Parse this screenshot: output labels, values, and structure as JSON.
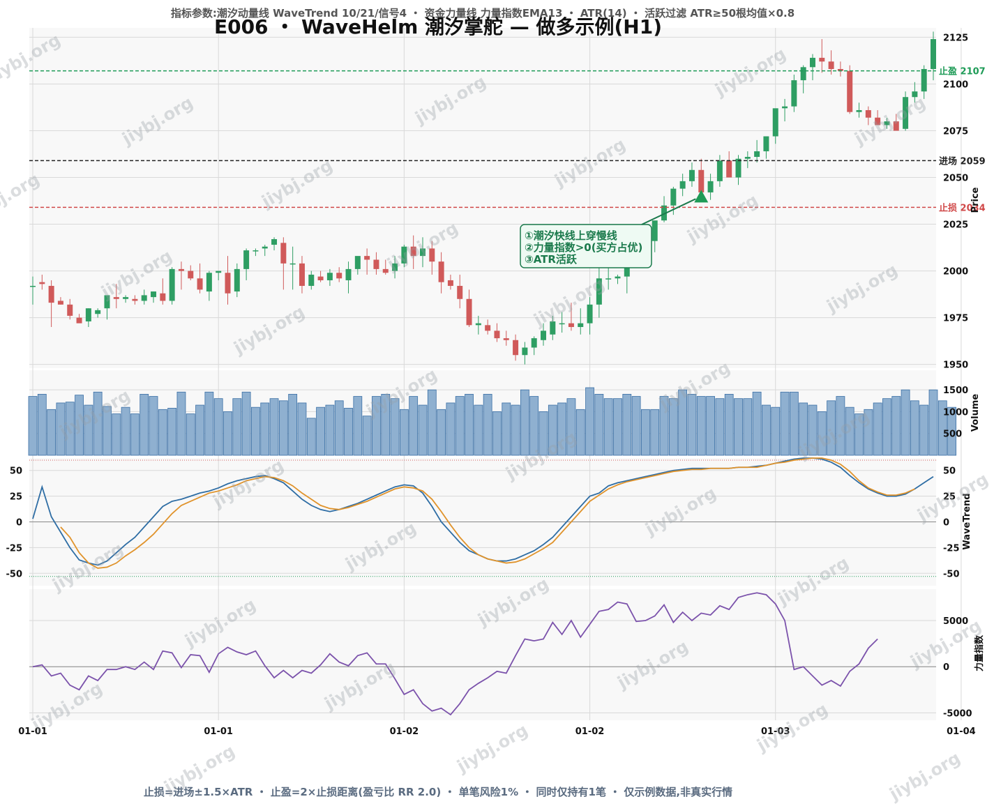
{
  "header": {
    "params": "指标参数:潮汐动量线 WaveTrend 10/21/信号4 ・ 资金力量线 力量指数EMA13 ・ ATR(14) ・ 活跃过滤 ATR≥50根均值×0.8",
    "title": "E006 ・ WaveHelm 潮汐掌舵 — 做多示例(H1)"
  },
  "footer": {
    "note": "止损=进场±1.5×ATR ・ 止盈=2×止损距离(盈亏比 RR 2.0) ・ 单笔风险1% ・ 同时仅持有1笔 ・ 仅示例数据,非真实行情"
  },
  "watermark": "jiybj.org",
  "colors": {
    "up": "#2e9e63",
    "down": "#d05a5a",
    "volume": "#8fb0d0",
    "volume_edge": "#3a6fa5",
    "wt_fast": "#2e6da4",
    "wt_slow": "#e0932b",
    "force": "#7b52ab",
    "take_profit": "#1e9b57",
    "entry": "#222222",
    "stop_loss": "#d04848",
    "annotation": "#1b7a4c",
    "annotation_bg": "#eefaf3"
  },
  "chart_data": [
    {
      "type": "candlestick",
      "ylabel": "Price",
      "ylim": [
        1948,
        2130
      ],
      "yticks": [
        1950,
        1975,
        2000,
        2025,
        2050,
        2075,
        2100,
        2125
      ],
      "xticklabels": [
        "01-01",
        "01-01",
        "01-02",
        "01-02",
        "01-03",
        "01-04"
      ],
      "xtick_positions": [
        0,
        20,
        40,
        60,
        80,
        100
      ],
      "levels": [
        {
          "name": "take_profit",
          "label": "止盈 2107",
          "value": 2107
        },
        {
          "name": "entry",
          "label": "进场 2059",
          "value": 2059
        },
        {
          "name": "stop_loss",
          "label": "止损 2034",
          "value": 2034
        }
      ],
      "entry_marker": {
        "index": 72,
        "price": 2040
      },
      "annotation": {
        "lines": [
          "①潮汐快线上穿慢线",
          "②力量指数>0(买方占优)",
          "③ATR活跃"
        ],
        "arrow_to_index": 72
      },
      "ohlc": [
        [
          1992,
          1997,
          1982,
          1992
        ],
        [
          1994,
          1998,
          1990,
          1993
        ],
        [
          1992,
          1995,
          1970,
          1983
        ],
        [
          1984,
          1986,
          1982,
          1982
        ],
        [
          1982,
          1985,
          1974,
          1976
        ],
        [
          1975,
          1977,
          1973,
          1972
        ],
        [
          1973,
          1980,
          1970,
          1980
        ],
        [
          1977,
          1980,
          1975,
          1979
        ],
        [
          1980,
          1987,
          1974,
          1987
        ],
        [
          1986,
          1993,
          1980,
          1985
        ],
        [
          1985,
          1987,
          1983,
          1986
        ],
        [
          1985,
          1987,
          1982,
          1984
        ],
        [
          1984,
          1990,
          1982,
          1987
        ],
        [
          1986,
          1989,
          1983,
          1989
        ],
        [
          1988,
          1996,
          1982,
          1984
        ],
        [
          1984,
          2002,
          1982,
          2001
        ],
        [
          2001,
          2005,
          1990,
          2000
        ],
        [
          2000,
          2003,
          1995,
          1996
        ],
        [
          1996,
          2004,
          1988,
          1990
        ],
        [
          1989,
          2000,
          1984,
          1999
        ],
        [
          1999,
          2000,
          1995,
          2000
        ],
        [
          1999,
          2008,
          1982,
          1988
        ],
        [
          1989,
          2004,
          1986,
          2001
        ],
        [
          2001,
          2012,
          1995,
          2011
        ],
        [
          2011,
          2012,
          2008,
          2011
        ],
        [
          2012,
          2014,
          2008,
          2013
        ],
        [
          2014,
          2018,
          2011,
          2017
        ],
        [
          2015,
          2018,
          1990,
          2004
        ],
        [
          2004,
          2013,
          1990,
          2004
        ],
        [
          2004,
          2008,
          1988,
          1992
        ],
        [
          1992,
          2000,
          1990,
          1998
        ],
        [
          1997,
          2000,
          1994,
          1995
        ],
        [
          1995,
          2001,
          1992,
          1999
        ],
        [
          1999,
          2002,
          1994,
          1996
        ],
        [
          1995,
          2005,
          1988,
          2001
        ],
        [
          2001,
          2005,
          1998,
          2008
        ],
        [
          2008,
          2012,
          1998,
          2006
        ],
        [
          2006,
          2010,
          1998,
          2001
        ],
        [
          2001,
          2006,
          1998,
          1999
        ],
        [
          2000,
          2008,
          1996,
          2004
        ],
        [
          2004,
          2014,
          2002,
          2013
        ],
        [
          2013,
          2019,
          2001,
          2008
        ],
        [
          2008,
          2018,
          2002,
          2012
        ],
        [
          2012,
          2016,
          1998,
          2005
        ],
        [
          2005,
          2010,
          1988,
          1994
        ],
        [
          1995,
          1998,
          1990,
          1992
        ],
        [
          1992,
          1998,
          1980,
          1985
        ],
        [
          1985,
          1990,
          1970,
          1971
        ],
        [
          1971,
          1976,
          1966,
          1972
        ],
        [
          1971,
          1974,
          1966,
          1968
        ],
        [
          1968,
          1972,
          1962,
          1964
        ],
        [
          1964,
          1968,
          1960,
          1963
        ],
        [
          1963,
          1966,
          1952,
          1955
        ],
        [
          1955,
          1962,
          1950,
          1959
        ],
        [
          1959,
          1965,
          1955,
          1964
        ],
        [
          1963,
          1972,
          1960,
          1968
        ],
        [
          1966,
          1976,
          1963,
          1973
        ],
        [
          1972,
          1978,
          1967,
          1972
        ],
        [
          1972,
          1983,
          1968,
          1970
        ],
        [
          1970,
          1980,
          1966,
          1972
        ],
        [
          1972,
          1986,
          1966,
          1982
        ],
        [
          1982,
          2002,
          1975,
          1996
        ],
        [
          1996,
          2002,
          1990,
          1996
        ],
        [
          1996,
          1998,
          1993,
          1997
        ],
        [
          1997,
          2008,
          1988,
          2007
        ],
        [
          2007,
          2012,
          2003,
          2011
        ],
        [
          2011,
          2018,
          2008,
          2016
        ],
        [
          2016,
          2026,
          2010,
          2027
        ],
        [
          2027,
          2040,
          2026,
          2035
        ],
        [
          2035,
          2045,
          2030,
          2044
        ],
        [
          2044,
          2052,
          2040,
          2048
        ],
        [
          2048,
          2058,
          2045,
          2054
        ],
        [
          2054,
          2060,
          2040,
          2042
        ],
        [
          2042,
          2052,
          2038,
          2048
        ],
        [
          2048,
          2062,
          2045,
          2059
        ],
        [
          2059,
          2064,
          2050,
          2050
        ],
        [
          2050,
          2062,
          2046,
          2060
        ],
        [
          2060,
          2064,
          2055,
          2061
        ],
        [
          2061,
          2070,
          2058,
          2064
        ],
        [
          2064,
          2072,
          2060,
          2072
        ],
        [
          2072,
          2082,
          2068,
          2087
        ],
        [
          2087,
          2092,
          2080,
          2088
        ],
        [
          2088,
          2105,
          2085,
          2102
        ],
        [
          2102,
          2110,
          2095,
          2109
        ],
        [
          2109,
          2116,
          2102,
          2114
        ],
        [
          2114,
          2124,
          2106,
          2112
        ],
        [
          2112,
          2118,
          2105,
          2108
        ],
        [
          2108,
          2112,
          2104,
          2107
        ],
        [
          2107,
          2110,
          2084,
          2085
        ],
        [
          2085,
          2090,
          2082,
          2086
        ],
        [
          2086,
          2088,
          2078,
          2082
        ],
        [
          2082,
          2086,
          2078,
          2078
        ],
        [
          2078,
          2082,
          2076,
          2080
        ],
        [
          2080,
          2084,
          2078,
          2075
        ],
        [
          2076,
          2096,
          2075,
          2093
        ],
        [
          2093,
          2101,
          2090,
          2096
        ],
        [
          2096,
          2110,
          2092,
          2108
        ],
        [
          2108,
          2128,
          2102,
          2124
        ]
      ]
    },
    {
      "type": "bar",
      "ylabel": "Volume",
      "ylim": [
        0,
        1950
      ],
      "yticks": [
        500,
        1000,
        1500
      ],
      "values": [
        1350,
        1400,
        1050,
        1200,
        1220,
        1380,
        1150,
        1450,
        1120,
        950,
        1100,
        950,
        1400,
        1350,
        1050,
        1080,
        1450,
        950,
        1150,
        1450,
        1300,
        1000,
        1300,
        1450,
        1100,
        1200,
        1300,
        1250,
        1400,
        1200,
        850,
        1100,
        1150,
        1250,
        1080,
        1350,
        900,
        1350,
        1400,
        1300,
        1050,
        1350,
        1150,
        1500,
        1050,
        1200,
        1350,
        1400,
        1150,
        1400,
        1000,
        1200,
        1150,
        1500,
        1350,
        1000,
        1150,
        1200,
        1300,
        1050,
        1550,
        1400,
        1300,
        1300,
        1400,
        1350,
        1050,
        1050,
        1350,
        1300,
        1500,
        1400,
        1350,
        1350,
        1300,
        1400,
        1300,
        1300,
        1450,
        1150,
        1100,
        1450,
        1450,
        1200,
        1150,
        1000,
        1250,
        1350,
        1100,
        950,
        1050,
        1200,
        1300,
        1350,
        1500,
        1250,
        1150,
        1500,
        1250,
        1100
      ]
    },
    {
      "type": "line",
      "ylabel": "WaveTrend",
      "ylim": [
        -62,
        62
      ],
      "yticks": [
        -50,
        -25,
        0,
        25,
        50
      ],
      "overbought": 60,
      "oversold": -53,
      "series": [
        {
          "name": "fast",
          "values": [
            3,
            34,
            5,
            -10,
            -25,
            -37,
            -40,
            -42,
            -38,
            -30,
            -22,
            -15,
            -5,
            5,
            15,
            20,
            22,
            25,
            28,
            30,
            33,
            37,
            40,
            42,
            44,
            45,
            42,
            38,
            30,
            22,
            16,
            12,
            10,
            12,
            15,
            18,
            22,
            26,
            30,
            34,
            36,
            35,
            28,
            15,
            0,
            -10,
            -20,
            -28,
            -32,
            -36,
            -38,
            -38,
            -36,
            -32,
            -28,
            -22,
            -15,
            -5,
            5,
            15,
            25,
            28,
            35,
            38,
            40,
            42,
            44,
            46,
            48,
            50,
            51,
            52,
            52,
            52,
            52,
            52,
            53,
            53,
            54,
            55,
            57,
            59,
            61,
            62,
            62,
            61,
            58,
            53,
            45,
            38,
            32,
            28,
            25,
            25,
            27,
            32,
            38,
            44
          ]
        },
        {
          "name": "slow",
          "values": [
            null,
            null,
            null,
            -5,
            -15,
            -30,
            -40,
            -45,
            -44,
            -40,
            -33,
            -27,
            -20,
            -12,
            -2,
            8,
            16,
            20,
            24,
            28,
            30,
            33,
            36,
            40,
            42,
            44,
            43,
            40,
            35,
            28,
            22,
            16,
            13,
            12,
            14,
            17,
            20,
            24,
            28,
            32,
            34,
            33,
            30,
            22,
            10,
            -3,
            -15,
            -25,
            -32,
            -36,
            -38,
            -40,
            -39,
            -36,
            -31,
            -26,
            -20,
            -10,
            0,
            10,
            20,
            26,
            32,
            36,
            39,
            41,
            43,
            45,
            47,
            49,
            50,
            51,
            51,
            52,
            52,
            52,
            53,
            53,
            53,
            55,
            57,
            58,
            60,
            61,
            62,
            62,
            60,
            56,
            49,
            40,
            33,
            29,
            26,
            26,
            28,
            32
          ]
        }
      ]
    },
    {
      "type": "line",
      "ylabel": "力量指数",
      "ylim": [
        -5800,
        8400
      ],
      "yticks": [
        -5000,
        0,
        5000
      ],
      "series": [
        {
          "name": "force_index",
          "values": [
            0,
            200,
            -1000,
            -700,
            -2000,
            -2500,
            -1000,
            -1500,
            -300,
            -300,
            0,
            -300,
            500,
            -300,
            1700,
            1500,
            -100,
            1300,
            1200,
            -600,
            1400,
            2100,
            1600,
            1300,
            1700,
            100,
            -1200,
            -400,
            -1200,
            -400,
            -700,
            200,
            1400,
            500,
            100,
            1200,
            1500,
            300,
            300,
            -1300,
            -3000,
            -2500,
            -4000,
            -4800,
            -4500,
            -5200,
            -4000,
            -2500,
            -1800,
            -1200,
            -500,
            -700,
            1200,
            3000,
            2800,
            3000,
            4800,
            3500,
            5000,
            3200,
            4600,
            6000,
            6200,
            7000,
            6800,
            4900,
            5000,
            5500,
            6700,
            4800,
            5900,
            5000,
            5800,
            5600,
            6600,
            6200,
            7500,
            7800,
            8000,
            7800,
            6800,
            5000,
            -300,
            0,
            -1000,
            -2000,
            -1500,
            -2100,
            -500,
            300,
            2000,
            3000
          ]
        }
      ]
    }
  ]
}
